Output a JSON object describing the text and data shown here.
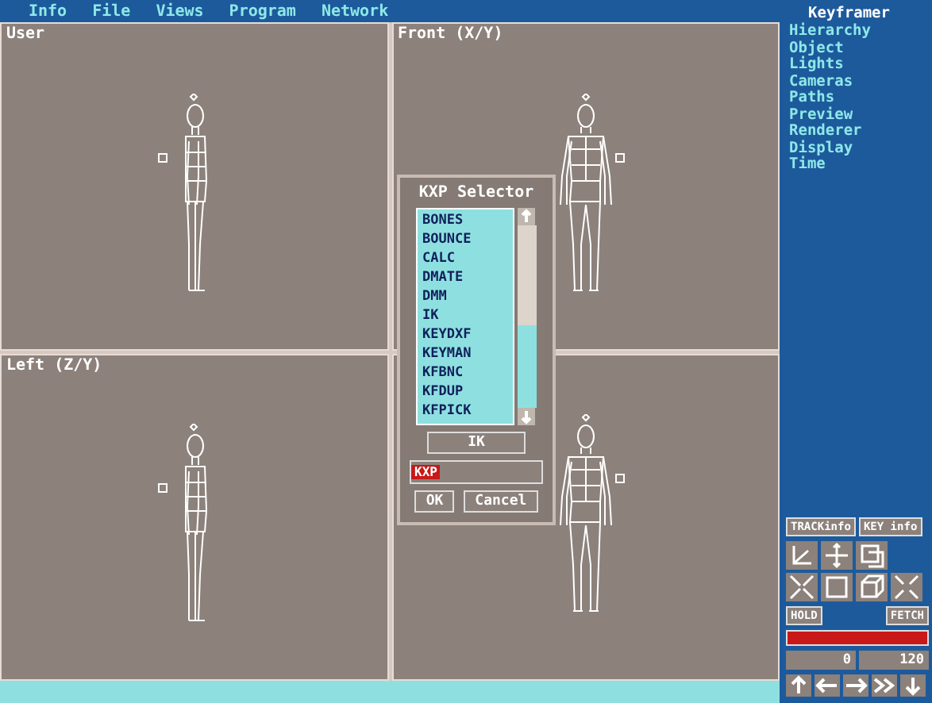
{
  "menu_bar": {
    "items": [
      "Info",
      "File",
      "Views",
      "Program",
      "Network"
    ]
  },
  "viewports": [
    {
      "label": "User",
      "kind": "side"
    },
    {
      "label": "Front (X/Y)",
      "kind": "front"
    },
    {
      "label": "Left (Z/Y)",
      "kind": "side"
    },
    {
      "kind": "front"
    }
  ],
  "dialog": {
    "title": "KXP Selector",
    "items": [
      "BONES",
      "BOUNCE",
      "CALC",
      "DMATE",
      "DMM",
      "IK",
      "KEYDXF",
      "KEYMAN",
      "KFBNC",
      "KFDUP",
      "KFPICK"
    ],
    "selection": "IK",
    "field": {
      "value": "KXP"
    },
    "buttons": [
      "OK",
      "Cancel"
    ]
  },
  "sidebar": {
    "title": "Keyframer",
    "items": [
      "Hierarchy",
      "Object",
      "Lights",
      "Cameras",
      "Paths",
      "Preview",
      "Renderer",
      "Display",
      "Time"
    ]
  },
  "toolbar": {
    "tabs": [
      "TRACKinfo",
      "KEY info"
    ],
    "hold": "HOLD",
    "fetch": "FETCH",
    "start_frame": "0",
    "end_frame": "120"
  }
}
